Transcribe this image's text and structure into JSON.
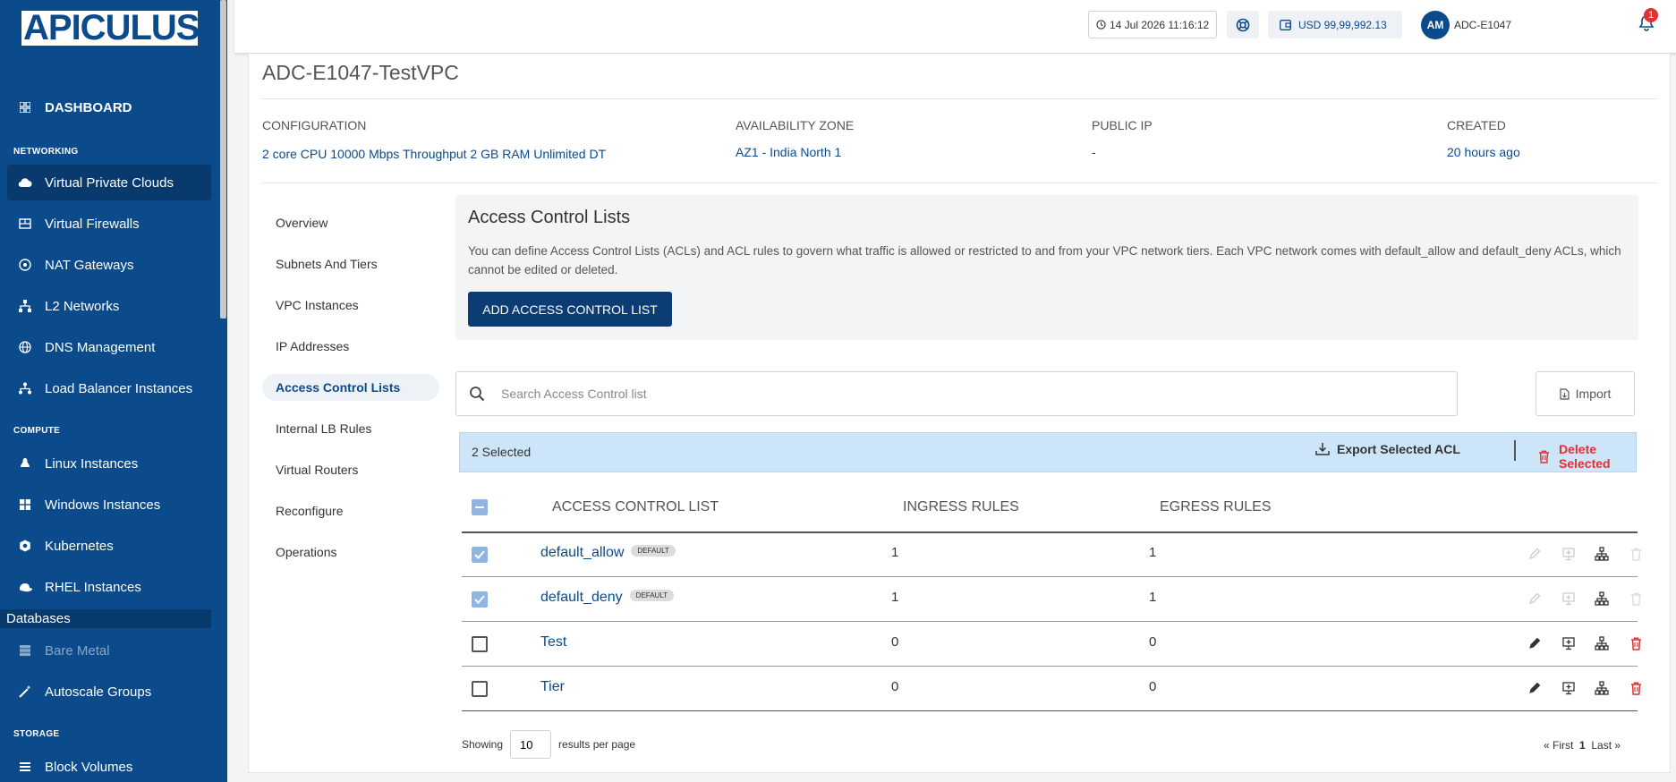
{
  "brand": {
    "logo_text": "APICULUS"
  },
  "sidebar": {
    "dashboard": "DASHBOARD",
    "networking_label": "NETWORKING",
    "networking": [
      "Virtual Private Clouds",
      "Virtual Firewalls",
      "NAT Gateways",
      "L2 Networks",
      "DNS Management",
      "Load Balancer Instances"
    ],
    "compute_label": "COMPUTE",
    "compute": [
      "Linux Instances",
      "Windows Instances",
      "Kubernetes",
      "RHEL Instances"
    ],
    "databases": "Databases",
    "bare_metal": "Bare Metal",
    "autoscale": "Autoscale Groups",
    "storage_label": "STORAGE",
    "block_volumes": "Block Volumes"
  },
  "header": {
    "datetime": "14 Jul 2026 11:16:12",
    "balance": "USD 99,99,992.13",
    "avatar_initials": "AM",
    "user": "ADC-E1047",
    "notifications": "1"
  },
  "page": {
    "title": "ADC-E1047-TestVPC",
    "meta": {
      "configuration_label": "CONFIGURATION",
      "configuration": "2 core CPU 10000 Mbps Throughput 2 GB RAM Unlimited DT",
      "az_label": "AVAILABILITY ZONE",
      "az": "AZ1 - India North 1",
      "ip_label": "PUBLIC IP",
      "ip": "-",
      "created_label": "CREATED",
      "created": "20 hours ago"
    },
    "subnav": [
      "Overview",
      "Subnets And Tiers",
      "VPC Instances",
      "IP Addresses",
      "Access Control Lists",
      "Internal LB Rules",
      "Virtual Routers",
      "Reconfigure",
      "Operations"
    ]
  },
  "acl": {
    "title": "Access Control Lists",
    "description": "You can define Access Control Lists (ACLs) and ACL rules to govern what traffic is allowed or restricted to and from your VPC network tiers. Each VPC network comes with default_allow and default_deny ACLs, which cannot be edited or deleted.",
    "add_button": "ADD ACCESS CONTROL LIST",
    "search_placeholder": "Search Access Control list",
    "import_button": "Import",
    "selected_count": "2 Selected",
    "export_button": "Export Selected ACL",
    "delete_button": "Delete Selected",
    "columns": [
      "ACCESS CONTROL LIST",
      "INGRESS RULES",
      "EGRESS RULES"
    ],
    "default_badge": "DEFAULT",
    "rows": [
      {
        "name": "default_allow",
        "ingress": "1",
        "egress": "1"
      },
      {
        "name": "default_deny",
        "ingress": "1",
        "egress": "1"
      },
      {
        "name": "Test",
        "ingress": "0",
        "egress": "0"
      },
      {
        "name": "Tier",
        "ingress": "0",
        "egress": "0"
      }
    ],
    "showing": "Showing",
    "per_page": "10",
    "results_per_page": "results per page",
    "pager": {
      "first": "« First",
      "page": "1",
      "last": "Last »"
    }
  },
  "colors": {
    "brand": "#0b4a8b",
    "danger": "#e03131",
    "selection_bg": "#cde5f9"
  }
}
